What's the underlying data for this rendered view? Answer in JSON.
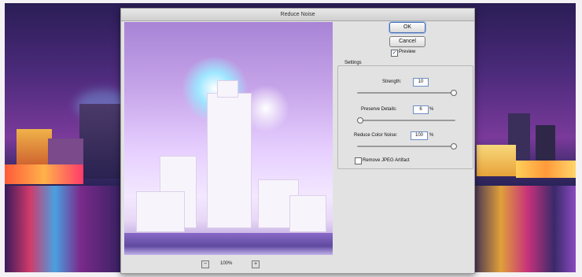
{
  "dialog": {
    "title": "Reduce Noise",
    "ok_label": "OK",
    "cancel_label": "Cancel",
    "preview_label": "Preview",
    "preview_checked": true,
    "zoom_level": "100%",
    "zoom_minus_icon": "zoom-out-icon",
    "zoom_plus_icon": "zoom-in-icon"
  },
  "settings": {
    "group_label": "Settings",
    "strength": {
      "label": "Strength:",
      "value": "10"
    },
    "preserve_details": {
      "label": "Preserve Details:",
      "value": "6",
      "unit": "%"
    },
    "reduce_color_noise": {
      "label": "Reduce Color Noise:",
      "value": "100",
      "unit": "%"
    },
    "remove_jpeg": {
      "label": "Remove JPEG Artifact",
      "checked": false
    }
  },
  "colors": {
    "dialog_bg": "#e2e2e2",
    "accent": "#4a6fb0",
    "photo_purple": "#7a3a9a"
  }
}
